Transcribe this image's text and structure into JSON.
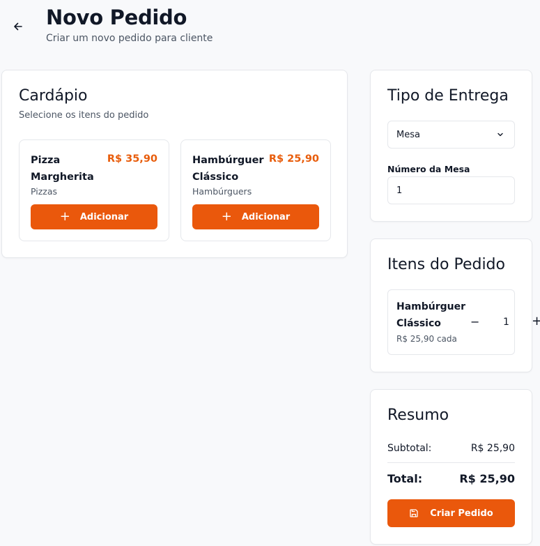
{
  "header": {
    "title": "Novo Pedido",
    "subtitle": "Criar um novo pedido para cliente"
  },
  "menu": {
    "title": "Cardápio",
    "subtitle": "Selecione os itens do pedido",
    "items": [
      {
        "name": "Pizza Margherita",
        "price": "R$ 35,90",
        "category": "Pizzas",
        "button": "Adicionar"
      },
      {
        "name": "Hambúrguer Clássico",
        "price": "R$ 25,90",
        "category": "Hambúrguers",
        "button": "Adicionar"
      }
    ]
  },
  "delivery": {
    "title": "Tipo de Entrega",
    "selected": "Mesa",
    "table_label": "Número da Mesa",
    "table_value": "1"
  },
  "order": {
    "title": "Itens do Pedido",
    "items": [
      {
        "name": "Hambúrguer Clássico",
        "unit_price": "R$ 25,90 cada",
        "quantity": "1",
        "minus": "−",
        "plus": "+"
      }
    ]
  },
  "summary": {
    "title": "Resumo",
    "subtotal_label": "Subtotal:",
    "subtotal_value": "R$ 25,90",
    "total_label": "Total:",
    "total_value": "R$ 25,90",
    "create_button": "Criar Pedido"
  },
  "colors": {
    "accent": "#ea580c",
    "price": "#e85d0c",
    "background": "#f8f9fb"
  }
}
